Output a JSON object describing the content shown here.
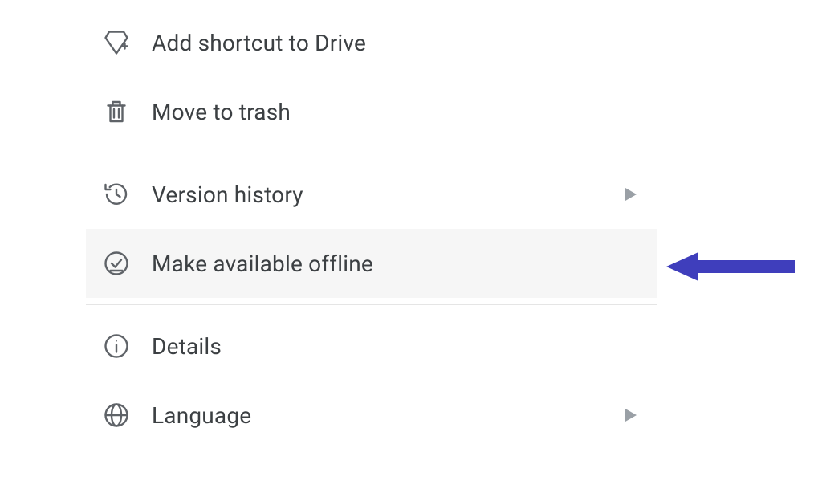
{
  "menu": {
    "items": [
      {
        "label": "Add shortcut to Drive"
      },
      {
        "label": "Move to trash"
      },
      {
        "label": "Version history"
      },
      {
        "label": "Make available offline"
      },
      {
        "label": "Details"
      },
      {
        "label": "Language"
      }
    ]
  },
  "annotation": {
    "target_label": "Make available offline",
    "arrow_color": "#3f3ebc"
  }
}
